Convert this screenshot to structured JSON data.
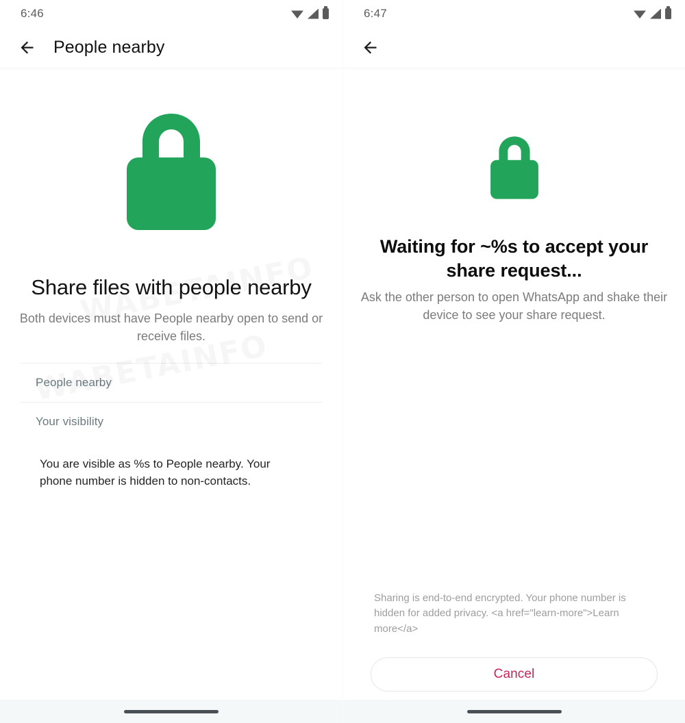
{
  "left": {
    "statusbar": {
      "time": "6:46",
      "icons": [
        "wifi-icon",
        "signal-icon",
        "battery-icon"
      ]
    },
    "appbar": {
      "back_icon": "arrow-left-icon",
      "title": "People nearby"
    },
    "hero": {
      "icon": "lock-icon",
      "color": "#22A45B"
    },
    "title": "Share files with people nearby",
    "subtitle": "Both devices must have People nearby open to send or receive files.",
    "rows": [
      {
        "label": "People nearby"
      },
      {
        "label": "Your visibility"
      }
    ],
    "visibility_description": "You are visible as %s to People nearby. Your phone number is hidden to non-contacts."
  },
  "right": {
    "statusbar": {
      "time": "6:47",
      "icons": [
        "wifi-icon",
        "signal-icon",
        "battery-icon"
      ]
    },
    "appbar": {
      "back_icon": "arrow-left-icon",
      "title": ""
    },
    "hero": {
      "icon": "lock-icon",
      "color": "#22A45B"
    },
    "title": "Waiting for ~%s to accept your share request...",
    "subtitle": "Ask the other person to open WhatsApp and shake their device to see your share request.",
    "disclaimer": "Sharing is end-to-end encrypted. Your phone number is hidden for added privacy. <a href=\"learn-more\">Learn more</a>",
    "cancel_label": "Cancel",
    "cancel_color": "#C4265C"
  },
  "watermark": {
    "text": "WABETAINFO"
  },
  "navbar": {
    "pill": "gesture-nav-pill"
  }
}
